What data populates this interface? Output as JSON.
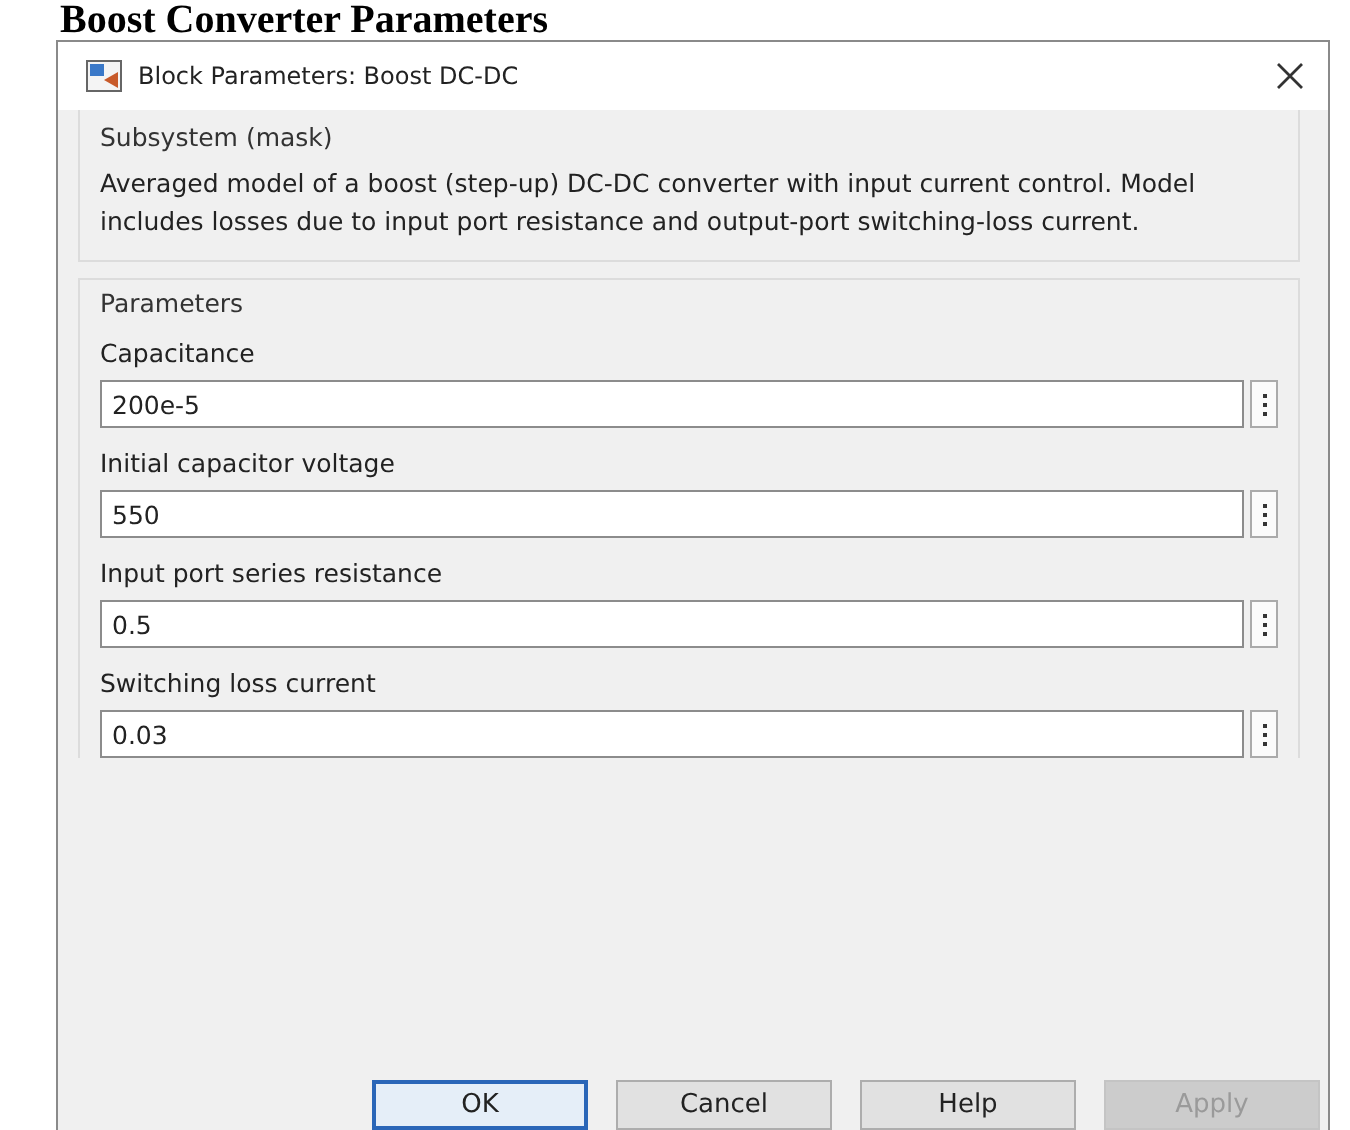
{
  "heading": "Boost Converter Parameters",
  "window": {
    "title": "Block Parameters: Boost DC-DC"
  },
  "mask": {
    "title": "Subsystem (mask)",
    "description": " Averaged model of a boost (step-up) DC-DC converter with input current control. Model includes losses due to input port resistance and output-port switching-loss current."
  },
  "parameters": {
    "title": "Parameters",
    "fields": [
      {
        "label": "Capacitance",
        "value": "200e-5"
      },
      {
        "label": "Initial capacitor voltage",
        "value": "550"
      },
      {
        "label": "Input port series resistance",
        "value": "0.5"
      },
      {
        "label": "Switching loss current",
        "value": "0.03"
      }
    ]
  },
  "buttons": [
    {
      "label": "OK",
      "default": true,
      "disabled": false
    },
    {
      "label": "Cancel",
      "default": false,
      "disabled": false
    },
    {
      "label": "Help",
      "default": false,
      "disabled": false
    },
    {
      "label": "Apply",
      "default": false,
      "disabled": true
    }
  ]
}
